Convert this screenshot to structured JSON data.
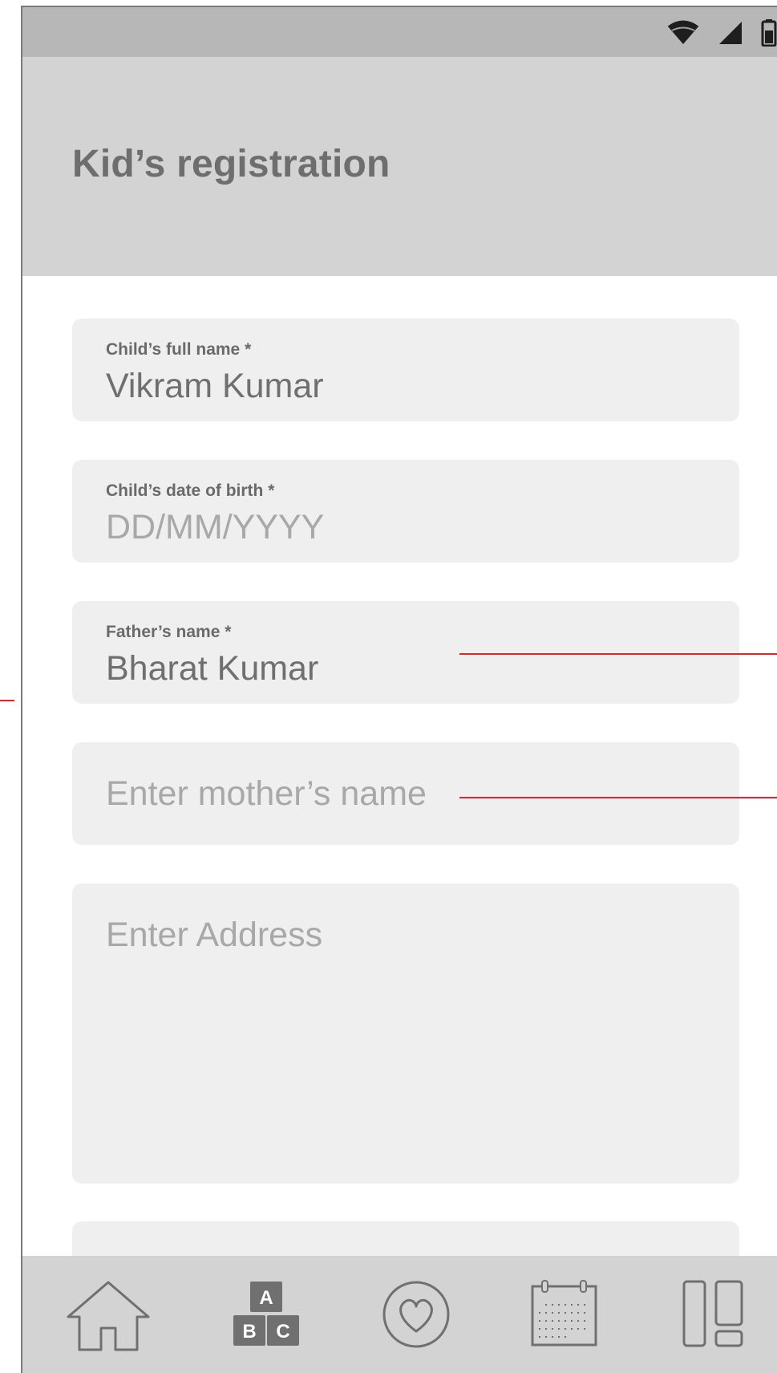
{
  "header": {
    "title": "Kid’s registration"
  },
  "form": {
    "child_name": {
      "label": "Child’s full name *",
      "value": "Vikram Kumar"
    },
    "child_dob": {
      "label": "Child’s date of birth *",
      "placeholder": "DD/MM/YYYY"
    },
    "father_name": {
      "label": "Father’s name *",
      "value": "Bharat Kumar"
    },
    "mother_name": {
      "placeholder": "Enter mother’s name"
    },
    "address": {
      "placeholder": "Enter Address"
    }
  },
  "status_bar": {
    "icons": [
      "wifi-icon",
      "cell-signal-icon",
      "battery-icon"
    ]
  },
  "bottom_nav": {
    "items": [
      "home-icon",
      "abc-blocks-icon",
      "heart-icon",
      "calendar-icon",
      "layout-icon"
    ],
    "blocks_letters": [
      "A",
      "B",
      "C"
    ]
  },
  "colors": {
    "status_bar": "#b7b7b7",
    "header": "#d3d3d3",
    "field_bg": "#efefef",
    "annotation": "#e8222b",
    "icon": "#707070"
  }
}
